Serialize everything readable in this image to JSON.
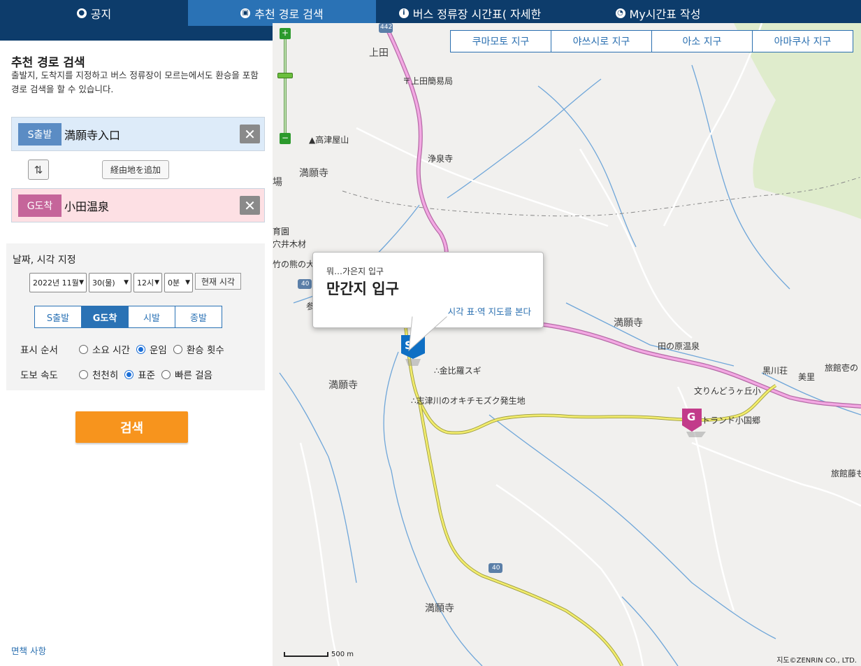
{
  "nav": {
    "tabs": [
      {
        "label": "공지",
        "icon": "bell-icon"
      },
      {
        "label": "추천 경로 검색",
        "icon": "bus-icon"
      },
      {
        "label": "버스 정류장 시간표( 자세한",
        "icon": "info-icon"
      },
      {
        "label": "My시간표 작성",
        "icon": "clock-icon"
      }
    ],
    "active": 1
  },
  "panel": {
    "title": "추천 경로 검색",
    "description": "출발지, 도착지를 지정하고 버스 정류장이 모르는에서도 환승을 포함 경로 검색을 할 수 있습니다.",
    "start": {
      "badge": "S출발",
      "name": "満願寺入口"
    },
    "goal": {
      "badge": "G도착",
      "name": "小田温泉"
    },
    "via_button": "経由地を追加",
    "datetime": {
      "title": "날짜, 시각 지정",
      "month": "2022년 11월",
      "day": "30(물)",
      "hour": "12시",
      "minute": "0분",
      "now_button": "현재 시각"
    },
    "mode": {
      "options": [
        "S출발",
        "G도착",
        "시발",
        "종발"
      ],
      "selected": "G도착"
    },
    "sort": {
      "label": "표시 순서",
      "options": [
        "소요 시간",
        "운임",
        "환승 횟수"
      ],
      "selected": "운임"
    },
    "walk": {
      "label": "도보 속도",
      "options": [
        "천천히",
        "표준",
        "빠른 걸음"
      ],
      "selected": "표준"
    },
    "search_button": "검색",
    "disclaimer": "면책 사항"
  },
  "map": {
    "districts": [
      "쿠마모토 지구",
      "야쓰시로 지구",
      "아소 지구",
      "아마쿠사 지구"
    ],
    "popup": {
      "sub": "뭐…가은지 입구",
      "title": "만간지 입구",
      "link": "시각 표·역 지도를 본다"
    },
    "markers": {
      "start": "S",
      "goal": "G"
    },
    "zoom": {
      "in": "+",
      "out": "−"
    },
    "labels": [
      {
        "text": "上田",
        "big": true
      },
      {
        "text": "〒上田簡易局"
      },
      {
        "text": "▲高津屋山"
      },
      {
        "text": "浄泉寺"
      },
      {
        "text": "満願寺",
        "big": true
      },
      {
        "text": "場",
        "big": true
      },
      {
        "text": "育園"
      },
      {
        "text": "穴井木材"
      },
      {
        "text": "竹の熊の大"
      },
      {
        "text": "参"
      },
      {
        "text": "満願寺",
        "big": true
      },
      {
        "text": "田の原温泉"
      },
      {
        "text": "黒川荘"
      },
      {
        "text": "美里"
      },
      {
        "text": "旅館壱の"
      },
      {
        "text": "∴金比羅スギ"
      },
      {
        "text": "満願寺",
        "big": true
      },
      {
        "text": "∴志津川のオキチモズク発生地"
      },
      {
        "text": "文りんどうヶ丘小"
      },
      {
        "text": "トランド小国郷"
      },
      {
        "text": "旅館藤も"
      },
      {
        "text": "満願寺",
        "big": true
      }
    ],
    "road_numbers": [
      "442",
      "40",
      "40"
    ],
    "scale": "500 m",
    "copyright": "지도©ZENRIN CO., LTD."
  }
}
